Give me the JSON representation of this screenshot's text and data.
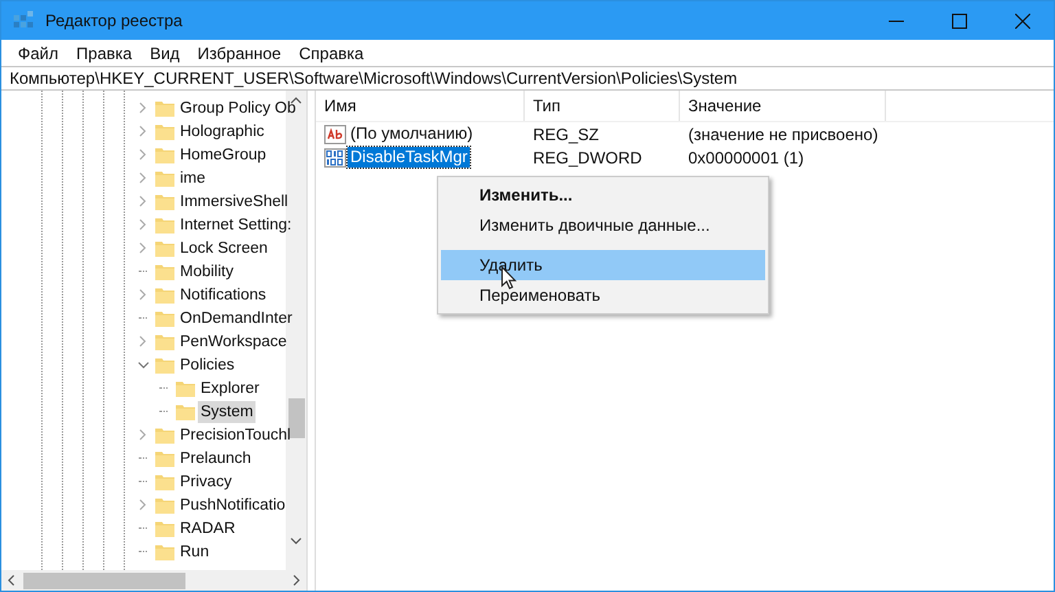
{
  "window": {
    "title": "Редактор реестра"
  },
  "menu": [
    "Файл",
    "Правка",
    "Вид",
    "Избранное",
    "Справка"
  ],
  "address": "Компьютер\\HKEY_CURRENT_USER\\Software\\Microsoft\\Windows\\CurrentVersion\\Policies\\System",
  "tree": [
    {
      "kind": "branch",
      "label": "Group Policy Ob",
      "expanded": false,
      "selected": false
    },
    {
      "kind": "branch",
      "label": "Holographic",
      "expanded": false,
      "selected": false
    },
    {
      "kind": "branch",
      "label": "HomeGroup",
      "expanded": false,
      "selected": false
    },
    {
      "kind": "branch",
      "label": "ime",
      "expanded": false,
      "selected": false
    },
    {
      "kind": "branch",
      "label": "ImmersiveShell",
      "expanded": false,
      "selected": false
    },
    {
      "kind": "branch",
      "label": "Internet Setting:",
      "expanded": false,
      "selected": false
    },
    {
      "kind": "branch",
      "label": "Lock Screen",
      "expanded": false,
      "selected": false
    },
    {
      "kind": "leaf",
      "label": "Mobility",
      "selected": false
    },
    {
      "kind": "branch",
      "label": "Notifications",
      "expanded": false,
      "selected": false
    },
    {
      "kind": "leaf",
      "label": "OnDemandInter",
      "selected": false
    },
    {
      "kind": "branch",
      "label": "PenWorkspace",
      "expanded": false,
      "selected": false
    },
    {
      "kind": "branch",
      "label": "Policies",
      "expanded": true,
      "selected": false,
      "children": [
        {
          "kind": "leaf",
          "label": "Explorer",
          "selected": false
        },
        {
          "kind": "leaf",
          "label": "System",
          "selected": true
        }
      ]
    },
    {
      "kind": "branch",
      "label": "PrecisionTouchl",
      "expanded": false,
      "selected": false
    },
    {
      "kind": "leaf",
      "label": "Prelaunch",
      "selected": false
    },
    {
      "kind": "leaf",
      "label": "Privacy",
      "selected": false
    },
    {
      "kind": "branch",
      "label": "PushNotificatio",
      "expanded": false,
      "selected": false
    },
    {
      "kind": "leaf",
      "label": "RADAR",
      "selected": false
    },
    {
      "kind": "leaf",
      "label": "Run",
      "selected": false
    }
  ],
  "columns": [
    "Имя",
    "Тип",
    "Значение"
  ],
  "values": [
    {
      "kind": "string",
      "name": "(По умолчанию)",
      "type": "REG_SZ",
      "data": "(значение не присвоено)",
      "selected": false
    },
    {
      "kind": "dword",
      "name": "DisableTaskMgr",
      "type": "REG_DWORD",
      "data": "0x00000001 (1)",
      "selected": true
    }
  ],
  "context_menu": [
    {
      "kind": "item",
      "label": "Изменить...",
      "default": true,
      "selected": false
    },
    {
      "kind": "item",
      "label": "Изменить двоичные данные...",
      "default": false,
      "selected": false
    },
    {
      "kind": "separator"
    },
    {
      "kind": "item",
      "label": "Удалить",
      "default": false,
      "selected": true
    },
    {
      "kind": "item",
      "label": "Переименовать",
      "default": false,
      "selected": false
    }
  ]
}
